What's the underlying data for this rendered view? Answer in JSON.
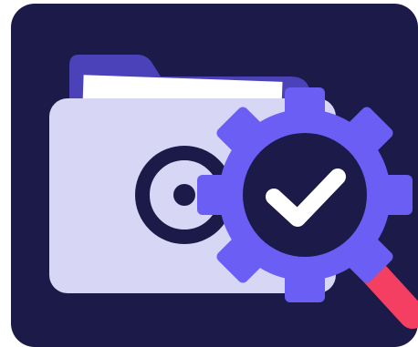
{
  "icon": {
    "name": "folder-settings-search-icon",
    "description_free": true
  },
  "colors": {
    "page_background": "#ffffff",
    "tile_background": "#1c1a48",
    "folder_back": "#4b41b8",
    "folder_front": "#d7d6f5",
    "paper": "#ffffff",
    "folder_symbol": "#1c1a48",
    "gear": "#6a5ef5",
    "gear_inner": "#1c1a48",
    "checkmark": "#ffffff",
    "magnifier_handle": "#f43f63"
  }
}
